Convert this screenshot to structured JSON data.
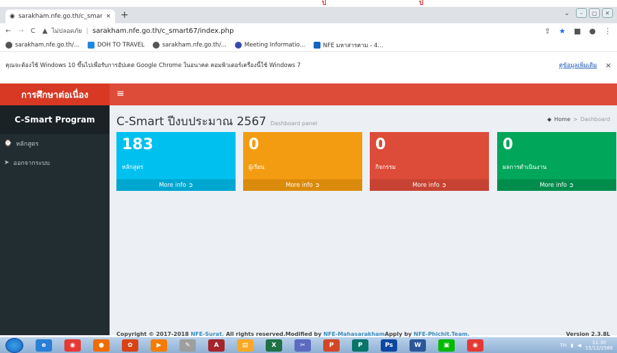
{
  "browser": {
    "tab_title": "sarakham.nfe.go.th/c_smart67/in",
    "tab_close": "×",
    "new_tab": "+",
    "top_marks": [
      "ป",
      "ป"
    ],
    "not_secure": "ไม่ปลอดภัย",
    "url": "sarakham.nfe.go.th/c_smart67/index.php",
    "bookmarks": [
      {
        "label": "sarakham.nfe.go.th/...",
        "color": "#555555"
      },
      {
        "label": "DOH TO TRAVEL",
        "color": "#1e88e5"
      },
      {
        "label": "sarakham.nfe.go.th/...",
        "color": "#555555"
      },
      {
        "label": "Meeting Informatio...",
        "color": "#3949ab"
      },
      {
        "label": "NFE มหาสารคาม - 4...",
        "color": "#1565c0"
      }
    ],
    "info_text": "คุณจะต้องใช้ Windows 10 ขึ้นไปเพื่อรับการอัปเดต Google Chrome ในอนาคต คอมพิวเตอร์เครื่องนี้ใช้ Windows 7",
    "info_link": "ดูข้อมูลเพิ่มเติม",
    "info_close": "×"
  },
  "app": {
    "logo": "การศึกษาต่อเนื่อง",
    "menu_icon": "≡",
    "program": "C-Smart Program",
    "menu": [
      {
        "label": "หลักสูตร",
        "icon": "clock-icon",
        "glyph": "⌚"
      },
      {
        "label": "ออกจากระบบ",
        "icon": "send-icon",
        "glyph": "➤"
      }
    ],
    "page_title": "C-Smart ปีงบประมาณ 2567",
    "page_subtitle": "Dashboard panel",
    "breadcrumb": {
      "home": "Home",
      "sep": ">",
      "current": "Dashboard"
    },
    "boxes": [
      {
        "value": "183",
        "label": "หลักสูตร",
        "more": "More info"
      },
      {
        "value": "0",
        "label": "ผู้เรียน",
        "more": "More info"
      },
      {
        "value": "0",
        "label": "กิจกรรม",
        "more": "More info"
      },
      {
        "value": "0",
        "label": "ผลการดำเนินงาน",
        "more": "More info"
      }
    ],
    "footer": {
      "prefix": "Copyright © 2017-2018 ",
      "org1": "NFE-Surat.",
      "mid1": " All rights reserved.Modified by ",
      "org2": "NFE-Mahasarakham",
      "mid2": "Apply by ",
      "org3": "NFE-Phichit.Team.",
      "version": "Version 2.3.8L"
    }
  },
  "taskbar": {
    "apps": [
      "IE",
      "Chrome",
      "Firefox",
      "Paint",
      "Media",
      "Tools",
      "Access",
      "Explorer",
      "Excel",
      "Snip",
      "PowerPoint",
      "Publisher",
      "Photoshop",
      "Word",
      "LINE",
      "Chrome2"
    ],
    "lang": "TH",
    "time": "11:30",
    "date": "15/12/2566"
  },
  "colors": {
    "header": "#dd4b39",
    "aqua": "#00c0ef",
    "yellow": "#f39c12",
    "red": "#dd4b39",
    "green": "#00a65a"
  }
}
